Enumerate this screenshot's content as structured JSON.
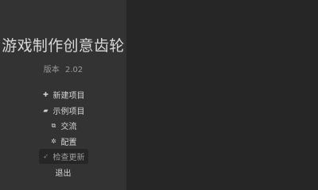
{
  "app": {
    "title": "游戏制作创意齿轮",
    "version_label": "版本",
    "version_number": "2.02"
  },
  "menu": {
    "items": [
      {
        "label": "新建项目",
        "icon": "plus-icon",
        "glyph": "✚"
      },
      {
        "label": "示例项目",
        "icon": "folder-icon",
        "glyph": "▰"
      },
      {
        "label": "交流",
        "icon": "external-link-icon",
        "glyph": "⧉"
      },
      {
        "label": "配置",
        "icon": "gear-icon",
        "glyph": "✲"
      },
      {
        "label": "检查更新",
        "icon": "rocket-icon",
        "glyph": "➶"
      },
      {
        "label": "退出",
        "icon": "",
        "glyph": ""
      }
    ]
  },
  "colors": {
    "left_panel": "#333333",
    "right_panel": "#262626",
    "highlight": "#262626",
    "text": "#d6d6d6"
  }
}
